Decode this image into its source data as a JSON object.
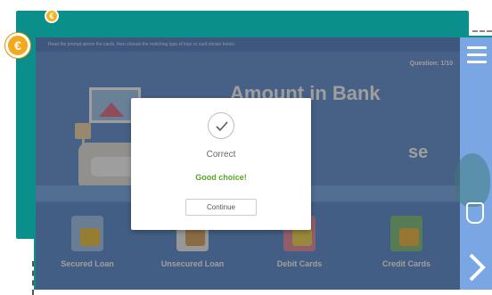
{
  "instruction": "Read the prompt above the cards, then choose the matching type of loan or card shown below.",
  "question_counter": "Question: 1/10",
  "title": "Amount in Bank",
  "title_trailing": "se",
  "cards": [
    {
      "label": "Secured Loan",
      "icon": "secured-loan-icon"
    },
    {
      "label": "Unsecured Loan",
      "icon": "unsecured-loan-icon"
    },
    {
      "label": "Debit Cards",
      "icon": "debit-card-icon"
    },
    {
      "label": "Credit Cards",
      "icon": "credit-card-icon"
    }
  ],
  "feedback": {
    "title": "Correct",
    "message": "Good choice!",
    "continue_label": "Continue",
    "icon": "checkmark-icon"
  },
  "coin_symbol": "€",
  "colors": {
    "teal": "#0a8f8a",
    "screen_blue": "#5f8fd4",
    "coin": "#f3b21e",
    "success": "#54a62c"
  }
}
